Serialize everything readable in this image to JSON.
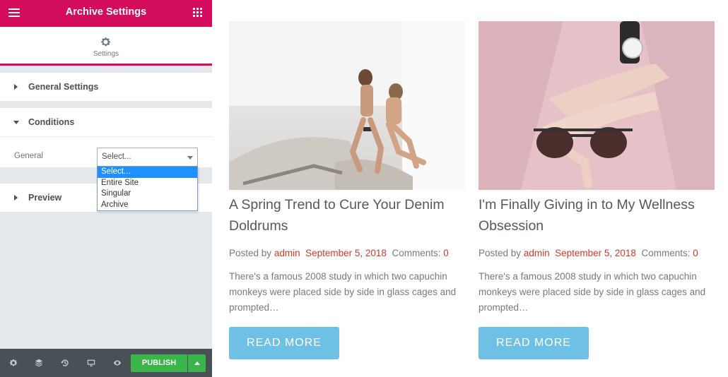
{
  "editor": {
    "title": "Archive Settings",
    "tab_label": "Settings",
    "sections": {
      "general_settings": "General Settings",
      "conditions": "Conditions",
      "preview": "Preview"
    },
    "conditions": {
      "field_label": "General",
      "selected": "Select...",
      "options": [
        "Select...",
        "Entire Site",
        "Singular",
        "Archive"
      ]
    },
    "footer": {
      "publish_label": "PUBLISH",
      "icons": [
        "gear-icon",
        "layers-icon",
        "history-icon",
        "responsive-icon",
        "eye-icon"
      ]
    },
    "colors": {
      "brand": "#d30c5c",
      "publish": "#39b54a",
      "accent_link": "#d33a2c",
      "button": "#6ec1e4"
    }
  },
  "posts": [
    {
      "title": "A Spring Trend to Cure Your Denim Doldrums",
      "posted_by_label": "Posted by",
      "author": "admin",
      "date": "September 5, 2018",
      "comments_label": "Comments:",
      "comments_count": "0",
      "excerpt": "There's a famous 2008 study in which two capuchin monkeys were placed side by side in glass cages and prompted…",
      "button_label": "READ MORE"
    },
    {
      "title": "I'm Finally Giving in to My Wellness Obsession",
      "posted_by_label": "Posted by",
      "author": "admin",
      "date": "September 5, 2018",
      "comments_label": "Comments:",
      "comments_count": "0",
      "excerpt": "There's a famous 2008 study in which two capuchin monkeys were placed side by side in glass cages and prompted…",
      "button_label": "READ MORE"
    }
  ]
}
